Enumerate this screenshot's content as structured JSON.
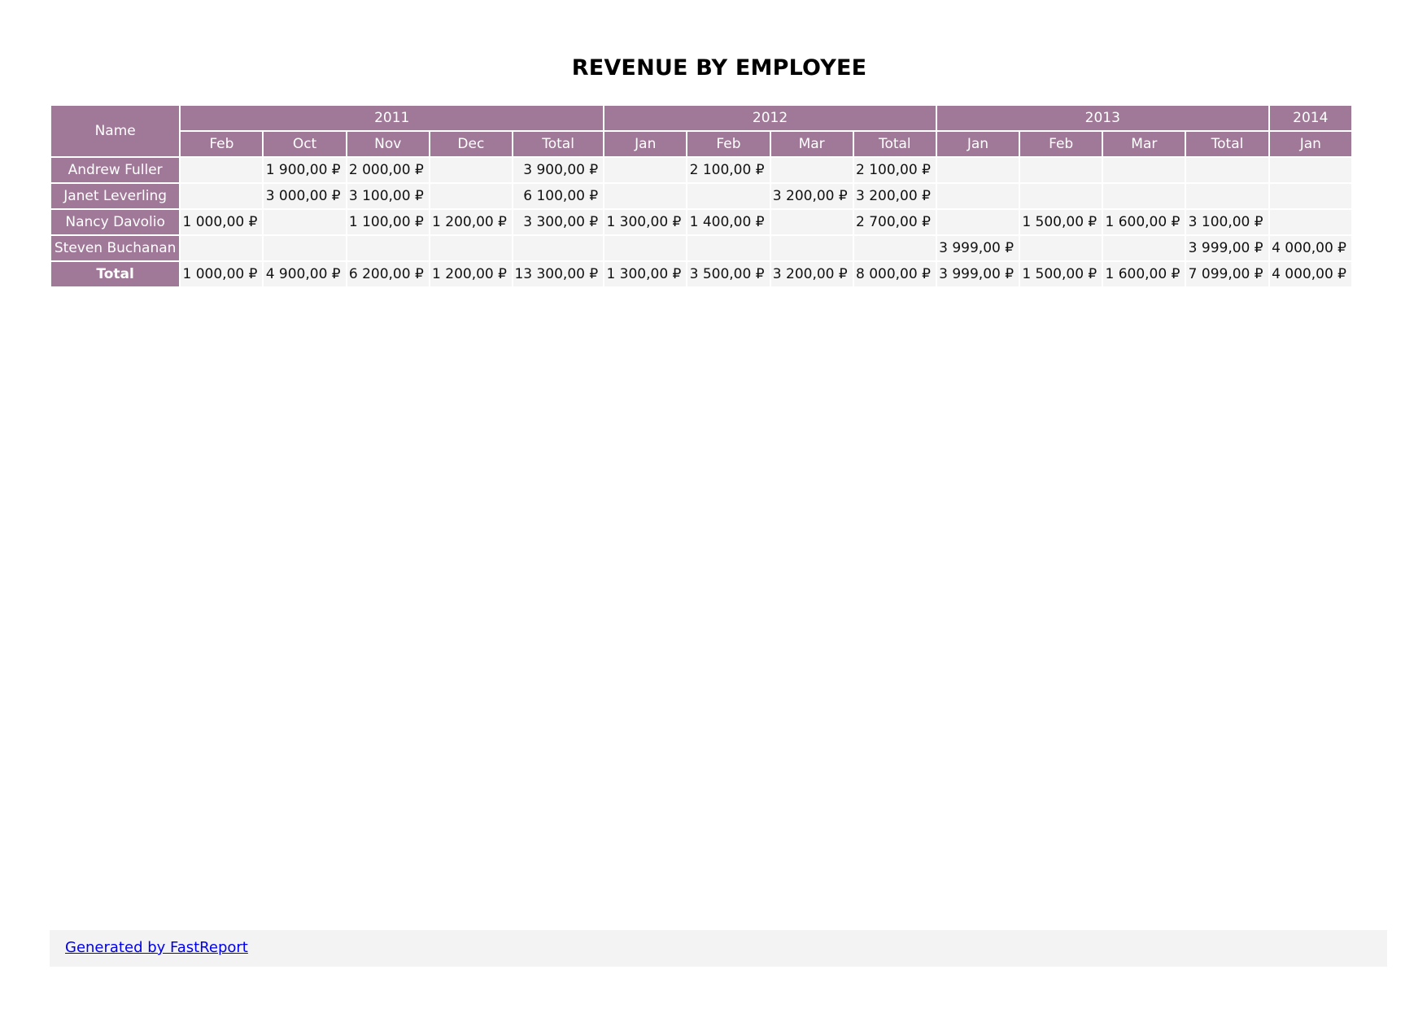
{
  "title": "REVENUE BY EMPLOYEE",
  "colors": {
    "header_bg": "#a07898",
    "header_text": "#ffffff",
    "cell_bg": "#f4f4f4",
    "link": "#0000ee"
  },
  "table": {
    "name_header": "Name",
    "years": [
      {
        "label": "2011",
        "months": [
          "Feb",
          "Oct",
          "Nov",
          "Dec",
          "Total"
        ]
      },
      {
        "label": "2012",
        "months": [
          "Jan",
          "Feb",
          "Mar",
          "Total"
        ]
      },
      {
        "label": "2013",
        "months": [
          "Jan",
          "Feb",
          "Mar",
          "Total"
        ]
      },
      {
        "label": "2014",
        "months": [
          "Jan"
        ]
      }
    ],
    "rows": [
      {
        "name": "Andrew Fuller",
        "values": [
          "",
          "1 900,00 ₽",
          "2 000,00 ₽",
          "",
          "3 900,00 ₽",
          "",
          "2 100,00 ₽",
          "",
          "2 100,00 ₽",
          "",
          "",
          "",
          "",
          ""
        ]
      },
      {
        "name": "Janet Leverling",
        "values": [
          "",
          "3 000,00 ₽",
          "3 100,00 ₽",
          "",
          "6 100,00 ₽",
          "",
          "",
          "3 200,00 ₽",
          "3 200,00 ₽",
          "",
          "",
          "",
          "",
          ""
        ]
      },
      {
        "name": "Nancy Davolio",
        "values": [
          "1 000,00 ₽",
          "",
          "1 100,00 ₽",
          "1 200,00 ₽",
          "3 300,00 ₽",
          "1 300,00 ₽",
          "1 400,00 ₽",
          "",
          "2 700,00 ₽",
          "",
          "1 500,00 ₽",
          "1 600,00 ₽",
          "3 100,00 ₽",
          ""
        ]
      },
      {
        "name": "Steven Buchanan",
        "values": [
          "",
          "",
          "",
          "",
          "",
          "",
          "",
          "",
          "",
          "3 999,00 ₽",
          "",
          "",
          "3 999,00 ₽",
          "4 000,00 ₽"
        ]
      },
      {
        "name": "Total",
        "is_total": true,
        "values": [
          "1 000,00 ₽",
          "4 900,00 ₽",
          "6 200,00 ₽",
          "1 200,00 ₽",
          "13 300,00 ₽",
          "1 300,00 ₽",
          "3 500,00 ₽",
          "3 200,00 ₽",
          "8 000,00 ₽",
          "3 999,00 ₽",
          "1 500,00 ₽",
          "1 600,00 ₽",
          "7 099,00 ₽",
          "4 000,00 ₽"
        ]
      }
    ]
  },
  "footer": {
    "link_text": "Generated by FastReport"
  }
}
